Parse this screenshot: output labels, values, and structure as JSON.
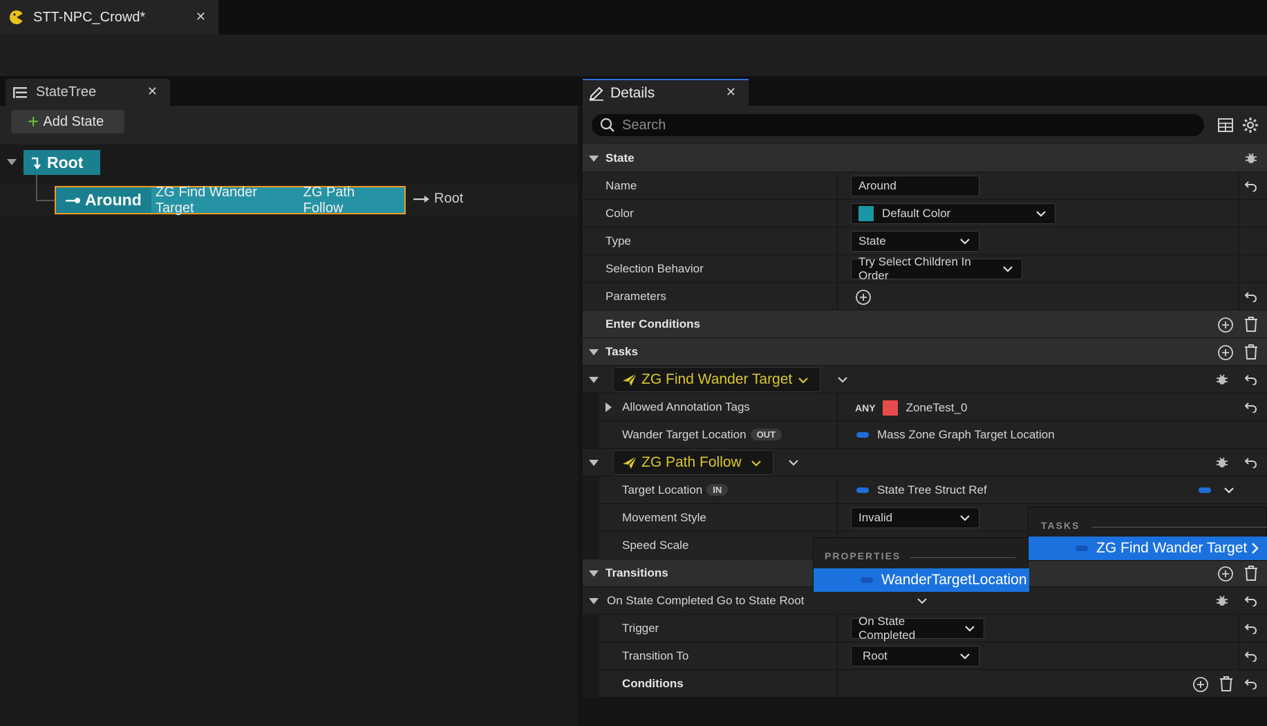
{
  "document_tab": {
    "title": "STT-NPC_Crowd*"
  },
  "statetree_panel": {
    "tab_label": "StateTree",
    "add_state_label": "Add State",
    "root_label": "Root",
    "around": {
      "name": "Around",
      "tasks": [
        "ZG Find Wander Target",
        "ZG Path Follow"
      ],
      "transition_target": "Root"
    }
  },
  "details_panel": {
    "tab_label": "Details",
    "search_placeholder": "Search",
    "state_category": "State",
    "name_label": "Name",
    "name_value": "Around",
    "color_label": "Color",
    "color_value": "Default Color",
    "color_swatch": "#1a96a6",
    "type_label": "Type",
    "type_value": "State",
    "selection_label": "Selection Behavior",
    "selection_value": "Try Select Children In Order",
    "parameters_label": "Parameters",
    "enter_conditions_label": "Enter Conditions",
    "tasks_category": "Tasks",
    "task1": {
      "name": "ZG Find Wander Target",
      "allowed_tags_label": "Allowed Annotation Tags",
      "allowed_tags_any": "ANY",
      "allowed_tags_value": "ZoneTest_0",
      "tag_color": "#e84b4b",
      "wander_label": "Wander Target Location",
      "wander_badge": "OUT",
      "wander_value": "Mass Zone Graph Target Location"
    },
    "task2": {
      "name": "ZG Path Follow",
      "target_label": "Target Location",
      "target_badge": "IN",
      "target_value": "State Tree Struct Ref",
      "movement_label": "Movement Style",
      "movement_value": "Invalid",
      "speed_label": "Speed Scale"
    },
    "transitions_category": "Transitions",
    "transition1": {
      "header": "On State Completed Go to State Root",
      "trigger_label": "Trigger",
      "trigger_value": "On State Completed",
      "transition_to_label": "Transition To",
      "transition_to_value": "Root",
      "conditions_label": "Conditions"
    }
  },
  "popup_properties": {
    "heading": "PROPERTIES",
    "item": "WanderTargetLocation"
  },
  "popup_tasks": {
    "heading": "TASKS",
    "item": "ZG Find Wander Target"
  },
  "colors": {
    "accent_teal": "#1a8090",
    "selection_blue": "#1b72de",
    "task_yellow": "#d9c72b",
    "selection_outline": "#f29a1e"
  }
}
